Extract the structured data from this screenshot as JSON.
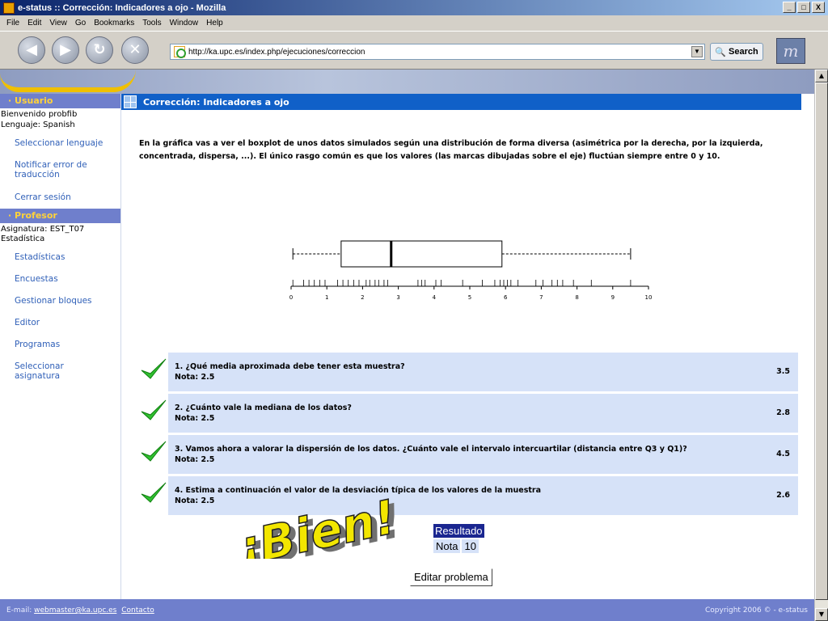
{
  "window": {
    "title": "e-status :: Corrección: Indicadores a ojo - Mozilla",
    "buttons": {
      "minimize": "_",
      "maximize": "□",
      "close": "X"
    }
  },
  "menu": [
    "File",
    "Edit",
    "View",
    "Go",
    "Bookmarks",
    "Tools",
    "Window",
    "Help"
  ],
  "nav": {
    "back": "◀",
    "forward": "▶",
    "reload": "↻",
    "stop": "✕",
    "url": "http://ka.upc.es/index.php/ejecuciones/correccion",
    "dropdown": "▼",
    "search_label": "Search",
    "search_glyph": "🔍",
    "logo": "m"
  },
  "scroll": {
    "up": "▲",
    "down": "▼"
  },
  "sidebar": {
    "usuario_head": "· Usuario",
    "welcome": "Bienvenido probfib",
    "language": "Lenguaje: Spanish",
    "user_links": [
      "Seleccionar lenguaje",
      "Notificar error de traducción",
      "Cerrar sesión"
    ],
    "profesor_head": "· Profesor",
    "subject": "Asignatura: EST_T07 Estadística",
    "prof_links": [
      "Estadísticas",
      "Encuestas",
      "Gestionar bloques",
      "Editor",
      "Programas",
      "Seleccionar asignatura"
    ]
  },
  "content": {
    "heading": "Corrección: Indicadores a ojo",
    "intro": "En la gráfica vas a ver el boxplot de unos datos simulados según una distribución de forma diversa (asimétrica por la derecha, por la izquierda, concentrada, dispersa, ...). El único rasgo común es que los valores (las marcas dibujadas sobre el eje) fluctúan siempre entre 0 y 10."
  },
  "chart_data": {
    "type": "boxplot",
    "min": 0.05,
    "q1": 1.4,
    "median": 2.8,
    "q3": 5.9,
    "max": 9.5,
    "xlim": [
      0,
      10
    ],
    "ticks": [
      "0",
      "1",
      "2",
      "3",
      "4",
      "5",
      "6",
      "7",
      "8",
      "9",
      "10"
    ],
    "rug": [
      0.05,
      0.35,
      0.5,
      0.65,
      0.8,
      0.95,
      1.3,
      1.45,
      1.6,
      1.75,
      1.9,
      2.1,
      2.2,
      2.35,
      2.45,
      2.6,
      2.7,
      3.55,
      3.65,
      3.75,
      4.05,
      4.2,
      4.8,
      5.35,
      5.7,
      5.85,
      5.95,
      6.05,
      6.15,
      6.35,
      6.85,
      7.05,
      7.3,
      7.45,
      7.6,
      7.9,
      8.4,
      9.5
    ]
  },
  "answers": [
    {
      "question": "1. ¿Qué media aproximada debe tener esta muestra?",
      "grade": "Nota: 2.5",
      "value": "3.5"
    },
    {
      "question": "2. ¿Cuánto vale la mediana de los datos?",
      "grade": "Nota: 2.5",
      "value": "2.8"
    },
    {
      "question": "3. Vamos ahora a valorar la dispersión de los datos. ¿Cuánto vale el intervalo intercuartilar (distancia entre Q3 y Q1)?",
      "grade": "Nota: 2.5",
      "value": "4.5"
    },
    {
      "question": "4. Estima a continuación el valor de la desviación típica de los valores de la muestra",
      "grade": "Nota: 2.5",
      "value": "2.6"
    }
  ],
  "bien_text": "¡Bien!",
  "result": {
    "title": "Resultado",
    "label": "Nota",
    "value": "10"
  },
  "edit_button": "Editar problema",
  "footer": {
    "email_label": "E-mail:",
    "email": "webmaster@ka.upc.es",
    "contact": "Contacto",
    "copyright": "Copyright 2006 © - e-status"
  }
}
